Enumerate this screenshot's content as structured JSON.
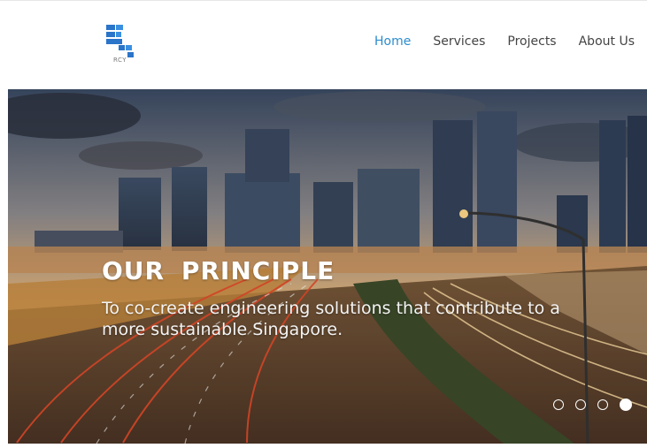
{
  "header": {
    "logo_text": "RCY",
    "nav": [
      {
        "label": "Home",
        "active": true
      },
      {
        "label": "Services",
        "active": false
      },
      {
        "label": "Projects",
        "active": false
      },
      {
        "label": "About Us",
        "active": false
      }
    ],
    "accent_color": "#2b8ccd"
  },
  "hero": {
    "title": "OUR  PRINCIPLE",
    "text": "To co-create engineering solutions that contribute to a more sustainable Singapore.",
    "slides": 4,
    "active_slide": 4
  }
}
